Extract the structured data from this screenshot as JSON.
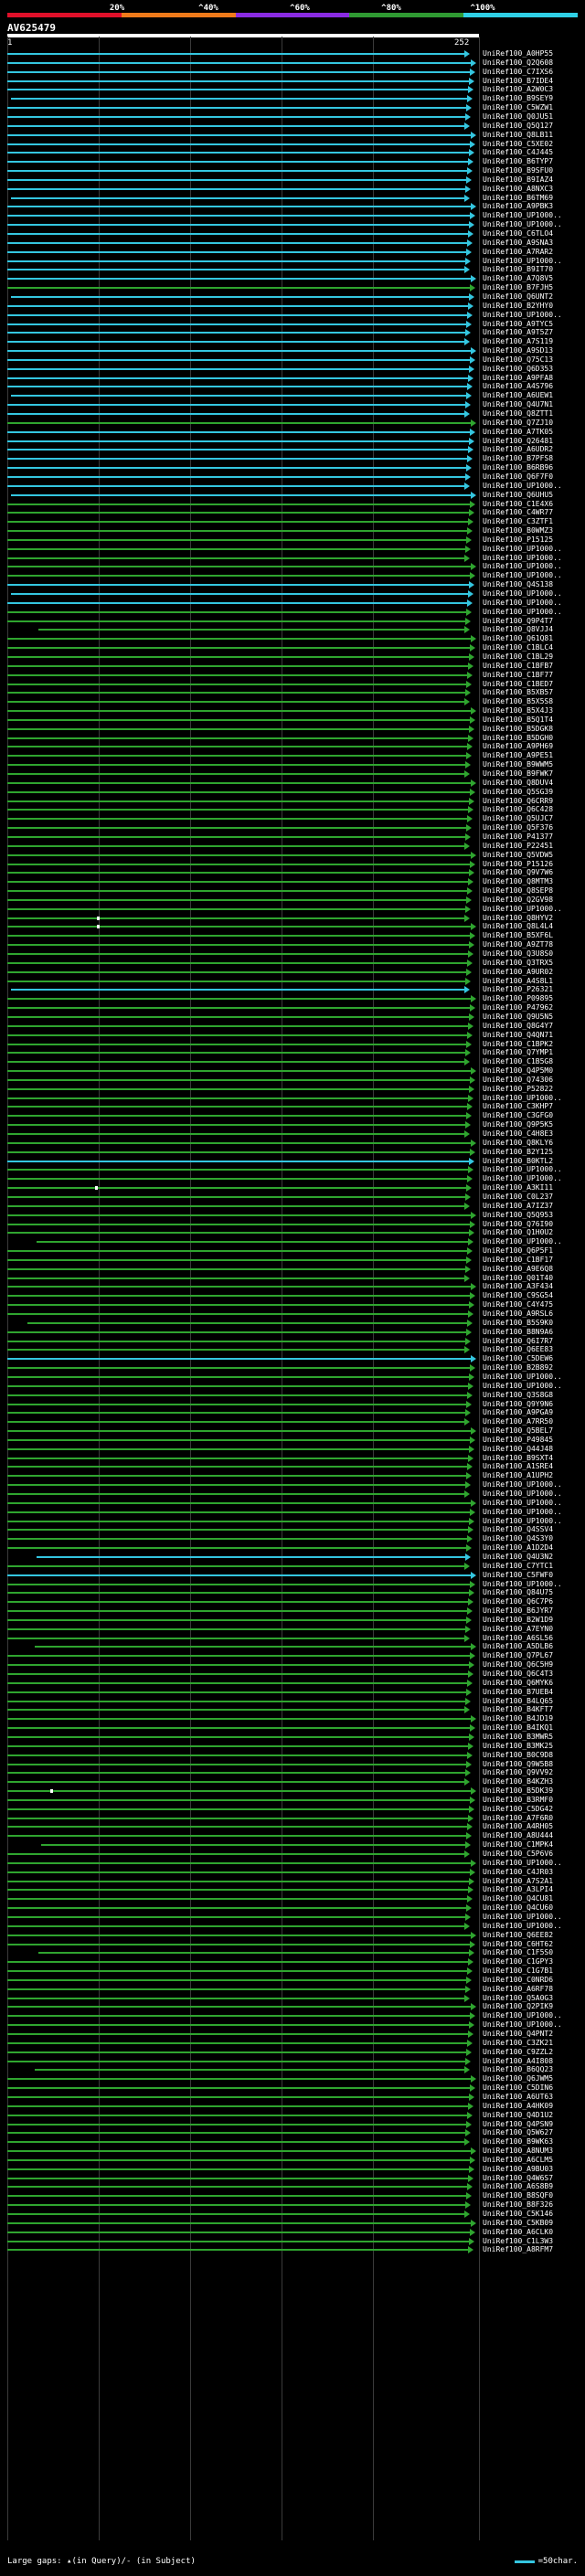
{
  "scale": {
    "labels": [
      "20%",
      "^40%",
      "^60%",
      "^80%",
      "^100%"
    ],
    "colors": [
      "#e0102a",
      "#ef7a1a",
      "#8a2be2",
      "#2f9a32",
      "#2fd0e6"
    ]
  },
  "query": {
    "title": "AV625479",
    "start": "1",
    "end": "252"
  },
  "hits": {
    "labels": [
      "UniRef100_A0HP55",
      "UniRef100_Q2Q608",
      "UniRef100_C7IXS6",
      "UniRef100_B7IDE4",
      "UniRef100_A2W0C3",
      "UniRef100_B9SEY9",
      "UniRef100_C5WZW1",
      "UniRef100_Q0JU51",
      "UniRef100_Q5Q127",
      "UniRef100_Q8LB11",
      "UniRef100_C5XE02",
      "UniRef100_C4J445",
      "UniRef100_B6TYP7",
      "UniRef100_B9SFU0",
      "UniRef100_B9IAZ4",
      "UniRef100_A8NXC3",
      "UniRef100_B6TM69",
      "UniRef100_A9PBK3",
      "UniRef100_UP1000..",
      "UniRef100_UP1000..",
      "UniRef100_C6TLO4",
      "UniRef100_A9SNA3",
      "UniRef100_A7RAR2",
      "UniRef100_UP1000..",
      "UniRef100_B9IT70",
      "UniRef100_A7Q8V5",
      "UniRef100_B7FJH5",
      "UniRef100_Q6UNT2",
      "UniRef100_B2YHY0",
      "UniRef100_UP1000..",
      "UniRef100_A9TYC5",
      "UniRef100_A9T5Z7",
      "UniRef100_A7S119",
      "UniRef100_A9SD13",
      "UniRef100_Q75C13",
      "UniRef100_Q6D353",
      "UniRef100_A9PFA8",
      "UniRef100_A4S796",
      "UniRef100_A6UEW1",
      "UniRef100_Q4U7N1",
      "UniRef100_Q8ZTT1",
      "UniRef100_Q7ZJ10",
      "UniRef100_A7TK05",
      "UniRef100_Q26481",
      "UniRef100_A6UDR2",
      "UniRef100_B7PFS8",
      "UniRef100_B6RB96",
      "UniRef100_Q6F7F0",
      "UniRef100_UP1000..",
      "UniRef100_Q6UHU5",
      "UniRef100_C1E4X6",
      "UniRef100_C4WR77",
      "UniRef100_C3ZTF1",
      "UniRef100_B0WMZ3",
      "UniRef100_P15125",
      "UniRef100_UP1000..",
      "UniRef100_UP1000..",
      "UniRef100_UP1000..",
      "UniRef100_UP1000..",
      "UniRef100_Q4S138",
      "UniRef100_UP1000..",
      "UniRef100_UP1000..",
      "UniRef100_UP1000..",
      "UniRef100_Q9P4T7",
      "UniRef100_Q8VJJ4",
      "UniRef100_Q61Q81",
      "UniRef100_C1BLC4",
      "UniRef100_C1BL29",
      "UniRef100_C1BFB7",
      "UniRef100_C1BF77",
      "UniRef100_C1BED7",
      "UniRef100_B5XB57",
      "UniRef100_B5X5S8",
      "UniRef100_B5X4J3",
      "UniRef100_B5Q1T4",
      "UniRef100_B5DGK8",
      "UniRef100_B5DGH0",
      "UniRef100_A9PH69",
      "UniRef100_A9PE51",
      "UniRef100_B9WWM5",
      "UniRef100_B9FWK7",
      "UniRef100_Q8DUV4",
      "UniRef100_Q5SG39",
      "UniRef100_Q6CRR9",
      "UniRef100_Q6C428",
      "UniRef100_Q5UJC7",
      "UniRef100_Q5F376",
      "UniRef100_P41377",
      "UniRef100_P22451",
      "UniRef100_Q5VDW5",
      "UniRef100_P15126",
      "UniRef100_Q9V7W6",
      "UniRef100_Q8MTM3",
      "UniRef100_Q8SEP8",
      "UniRef100_Q2GV98",
      "UniRef100_UP1000..",
      "UniRef100_Q8HYV2",
      "UniRef100_Q8L4L4",
      "UniRef100_B5XF6L",
      "UniRef100_A9ZT78",
      "UniRef100_Q3U8S0",
      "UniRef100_Q3TRX5",
      "UniRef100_A9UR02",
      "UniRef100_A4S8L1",
      "UniRef100_P26321",
      "UniRef100_P09895",
      "UniRef100_P47962",
      "UniRef100_Q9U5N5",
      "UniRef100_Q8G4Y7",
      "UniRef100_Q4QN71",
      "UniRef100_C1BPK2",
      "UniRef100_Q7YMP1",
      "UniRef100_C1B5G8",
      "UniRef100_Q4P5M0",
      "UniRef100_Q74306",
      "UniRef100_P52822",
      "UniRef100_UP1000..",
      "UniRef100_C3KHP7",
      "UniRef100_C3GFG0",
      "UniRef100_Q9P5K5",
      "UniRef100_C4H8E3",
      "UniRef100_Q8KLY6",
      "UniRef100_B2Y125",
      "UniRef100_B0KTL2",
      "UniRef100_UP1000..",
      "UniRef100_UP1000..",
      "UniRef100_A3KI11",
      "UniRef100_C0L237",
      "UniRef100_A7IZ37",
      "UniRef100_Q5Q953",
      "UniRef100_Q76I90",
      "UniRef100_Q1H0U2",
      "UniRef100_UP1000..",
      "UniRef100_Q6P5F1",
      "UniRef100_C1BF17",
      "UniRef100_A9E6Q8",
      "UniRef100_Q01T40",
      "UniRef100_A3F434",
      "UniRef100_C9SG54",
      "UniRef100_C4Y475",
      "UniRef100_A9RSL6",
      "UniRef100_B5S9K0",
      "UniRef100_B8N9A6",
      "UniRef100_Q6I7R7",
      "UniRef100_Q6EE83",
      "UniRef100_C5DEW6",
      "UniRef100_B2B892",
      "UniRef100_UP1000..",
      "UniRef100_UP1000..",
      "UniRef100_Q3S8G8",
      "UniRef100_Q9Y9N6",
      "UniRef100_A9PGA9",
      "UniRef100_A7RR50",
      "UniRef100_Q5BEL7",
      "UniRef100_P49845",
      "UniRef100_Q44J48",
      "UniRef100_B9SXT4",
      "UniRef100_A1SRE4",
      "UniRef100_A1UPH2",
      "UniRef100_UP1000..",
      "UniRef100_UP1000..",
      "UniRef100_UP1000..",
      "UniRef100_UP1000..",
      "UniRef100_UP1000..",
      "UniRef100_Q4SSV4",
      "UniRef100_Q4S3Y0",
      "UniRef100_A1D2D4",
      "UniRef100_Q4U3N2",
      "UniRef100_C7YTC1",
      "UniRef100_C5FWF0",
      "UniRef100_UP1000..",
      "UniRef100_Q84U75",
      "UniRef100_Q6C7P6",
      "UniRef100_B6JYR7",
      "UniRef100_B2W1D9",
      "UniRef100_A7EYN0",
      "UniRef100_A6SL56",
      "UniRef100_A5DLB6",
      "UniRef100_Q7PL67",
      "UniRef100_Q6C5H9",
      "UniRef100_Q6C4T3",
      "UniRef100_Q6MYK6",
      "UniRef100_B7UEB4",
      "UniRef100_B4LQ65",
      "UniRef100_B4KFT7",
      "UniRef100_B4JD19",
      "UniRef100_B4IKQ1",
      "UniRef100_B3MWR5",
      "UniRef100_B3MK25",
      "UniRef100_B0C9D8",
      "UniRef100_Q9W5B8",
      "UniRef100_Q9VV92",
      "UniRef100_B4KZH3",
      "UniRef100_B5DK39",
      "UniRef100_B3RMF0",
      "UniRef100_C5DG42",
      "UniRef100_A7F6R0",
      "UniRef100_A4RH05",
      "UniRef100_A8U444",
      "UniRef100_C1MPK4",
      "UniRef100_C5P6V6",
      "UniRef100_UP1000..",
      "UniRef100_C4JR03",
      "UniRef100_A7S2A1",
      "UniRef100_A3LPI4",
      "UniRef100_Q4CU81",
      "UniRef100_Q4CU60",
      "UniRef100_UP1000..",
      "UniRef100_UP1000..",
      "UniRef100_Q6EE82",
      "UniRef100_C6HT62",
      "UniRef100_C1F5S0",
      "UniRef100_C1GPY3",
      "UniRef100_C1G7B1",
      "UniRef100_C0NRD6",
      "UniRef100_A6RF78",
      "UniRef100_Q5A0G3",
      "UniRef100_Q2PIK9",
      "UniRef100_UP1000..",
      "UniRef100_UP1000..",
      "UniRef100_Q4PNT2",
      "UniRef100_C3ZK21",
      "UniRef100_C9ZZL2",
      "UniRef100_A4I808",
      "UniRef100_B6QQ23",
      "UniRef100_Q6JWM5",
      "UniRef100_C5DIN6",
      "UniRef100_A6UT63",
      "UniRef100_A4HK09",
      "UniRef100_Q4D1U2",
      "UniRef100_Q4PSN9",
      "UniRef100_Q5W627",
      "UniRef100_B9WK63",
      "UniRef100_A8NUM3",
      "UniRef100_A6CLM5",
      "UniRef100_A9BU03",
      "UniRef100_Q4W6S7",
      "UniRef100_A6S8B9",
      "UniRef100_B8SQF0",
      "UniRef100_B8F326",
      "UniRef100_C5K146",
      "UniRef100_C5KB09",
      "UniRef100_A6CLK0",
      "UniRef100_C1L3W3",
      "UniRef100_A8RFM7"
    ],
    "colors": [
      "cyan",
      "cyan",
      "cyan",
      "cyan",
      "cyan",
      "cyan",
      "cyan",
      "cyan",
      "cyan",
      "cyan",
      "cyan",
      "cyan",
      "cyan",
      "cyan",
      "cyan",
      "cyan",
      "cyan",
      "cyan",
      "cyan",
      "cyan",
      "cyan",
      "cyan",
      "cyan",
      "cyan",
      "cyan",
      "cyan",
      "green",
      "cyan",
      "cyan",
      "cyan",
      "cyan",
      "cyan",
      "cyan",
      "cyan",
      "cyan",
      "cyan",
      "cyan",
      "cyan",
      "cyan",
      "cyan",
      "cyan",
      "green",
      "cyan",
      "cyan",
      "cyan",
      "cyan",
      "cyan",
      "cyan",
      "cyan",
      "cyan",
      "green",
      "green",
      "green",
      "green",
      "green",
      "green",
      "green",
      "green",
      "green",
      "cyan",
      "cyan",
      "cyan",
      "green",
      "green",
      "green",
      "green",
      "green",
      "green",
      "green",
      "green",
      "green",
      "green",
      "green",
      "green",
      "green",
      "green",
      "green",
      "green",
      "green",
      "green",
      "green",
      "green",
      "green",
      "green",
      "green",
      "green",
      "green",
      "green",
      "green",
      "green",
      "green",
      "green",
      "green",
      "green",
      "green",
      "green",
      "green",
      "green",
      "green",
      "green",
      "green",
      "green",
      "green",
      "green",
      "cyan",
      "green",
      "green",
      "green",
      "green",
      "green",
      "green",
      "green",
      "green",
      "green",
      "green",
      "green",
      "green",
      "green",
      "green",
      "green",
      "green",
      "green",
      "green",
      "cyan",
      "green",
      "green",
      "green",
      "green",
      "green",
      "green",
      "green",
      "green",
      "green",
      "green",
      "green",
      "green",
      "green",
      "green",
      "green",
      "green",
      "green",
      "green",
      "green",
      "green",
      "green",
      "cyan",
      "green",
      "green",
      "green",
      "green",
      "green",
      "green",
      "green",
      "green",
      "green",
      "green",
      "green",
      "green",
      "green",
      "green",
      "green",
      "green",
      "green",
      "green",
      "green",
      "green",
      "green",
      "cyan",
      "green",
      "cyan",
      "green",
      "green",
      "green",
      "green",
      "green",
      "green",
      "green",
      "green",
      "green",
      "green",
      "green",
      "green",
      "green",
      "green",
      "green",
      "green",
      "green",
      "green",
      "green",
      "green",
      "green",
      "green",
      "green",
      "green",
      "green",
      "green",
      "green",
      "green",
      "green",
      "green",
      "green",
      "green",
      "green",
      "green",
      "green",
      "green",
      "green",
      "green",
      "green",
      "green",
      "green",
      "green",
      "green",
      "green",
      "green",
      "green",
      "green",
      "green",
      "green",
      "green",
      "green",
      "green",
      "green",
      "green",
      "green",
      "green",
      "green",
      "green",
      "green",
      "green",
      "green",
      "green",
      "green",
      "green",
      "green",
      "green",
      "green",
      "green",
      "green",
      "green",
      "green",
      "green",
      "green",
      "green",
      "green"
    ],
    "palette": {
      "cyan": "#34c6e0",
      "green": "#2fa52f"
    }
  },
  "legend": {
    "text": "Large gaps: ▴(in Query)/- (in Subject)",
    "swatch_text": "=50char."
  }
}
